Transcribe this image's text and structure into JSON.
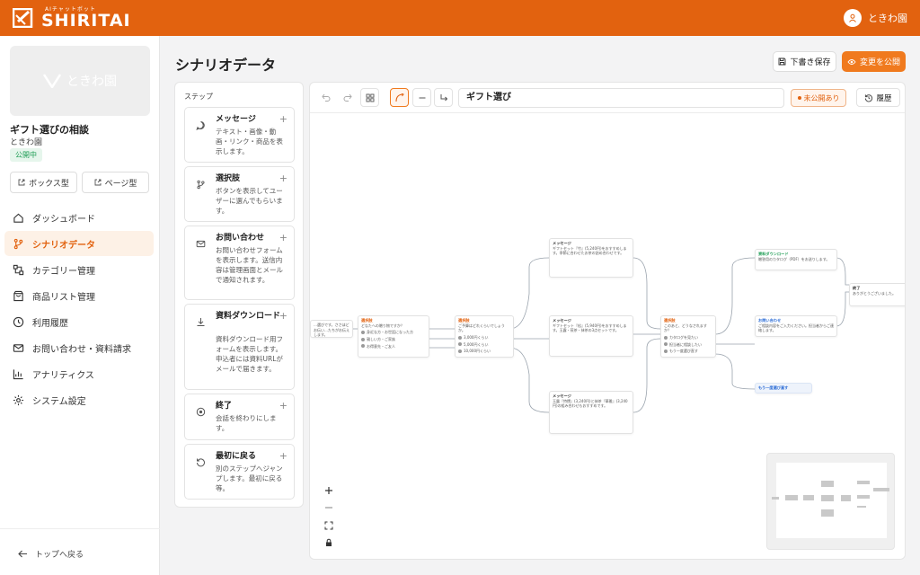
{
  "header": {
    "logo_sub": "AIチャットボット",
    "logo_main": "SHIRITAI",
    "user_name": "ときわ園"
  },
  "project": {
    "thumb_text": "ときわ園",
    "title": "ギフト選びの相談",
    "owner": "ときわ園",
    "status": "公開中",
    "box_type": "ボックス型",
    "page_type": "ページ型"
  },
  "nav": [
    {
      "label": "ダッシュボード",
      "icon": "home-icon"
    },
    {
      "label": "シナリオデータ",
      "icon": "branch-icon",
      "active": true
    },
    {
      "label": "カテゴリー管理",
      "icon": "category-icon"
    },
    {
      "label": "商品リスト管理",
      "icon": "bag-icon"
    },
    {
      "label": "利用履歴",
      "icon": "clock-icon"
    },
    {
      "label": "お問い合わせ・資料請求",
      "icon": "mail-icon"
    },
    {
      "label": "アナリティクス",
      "icon": "chart-icon"
    },
    {
      "label": "システム設定",
      "icon": "gear-icon"
    }
  ],
  "back_label": "トップへ戻る",
  "page_title": "シナリオデータ",
  "actions": {
    "draft": "下書き保存",
    "publish": "変更を公開"
  },
  "steps_label": "ステップ",
  "steps": [
    {
      "title": "メッセージ",
      "desc": "テキスト・画像・動画・リンク・商品を表示します。"
    },
    {
      "title": "選択肢",
      "desc": "ボタンを表示してユーザーに選んでもらいます。"
    },
    {
      "title": "お問い合わせ",
      "desc": "お問い合わせフォームを表示します。送信内容は管理画面とメールで通知されます。"
    },
    {
      "title": "資料ダウンロード",
      "desc": "資料ダウンロード用フォームを表示します。申込者には資料URLがメールで届きます。"
    },
    {
      "title": "終了",
      "desc": "会話を終わりにします。"
    },
    {
      "title": "最初に戻る",
      "desc": "別のステップへジャンプします。最初に戻る等。"
    }
  ],
  "editor": {
    "scenario_name": "ギフト選び",
    "unpublished": "未公開あり",
    "history": "履歴"
  },
  "flow": {
    "start_text": "…選びです。ささほどお伝い…たちがお伝えします。",
    "choice1": {
      "title": "選択肢",
      "q": "どなたへの贈り物ですか？",
      "options": [
        "身近な方・お世話になった方",
        "親しい方・ご家族",
        "お得意先・ご友人"
      ]
    },
    "choice2": {
      "title": "選択肢",
      "q": "ご予算はどれくらいでしょうか。",
      "options": [
        "3,000円くらい",
        "5,000円くらい",
        "10,000円くらい"
      ]
    },
    "msg1": {
      "title": "メッセージ",
      "text": "ギフトセット『竹』(5,240円)をおすすめします。季節に合わせたお茶の詰め合わせです。"
    },
    "msg2": {
      "title": "メッセージ",
      "text": "ギフトセット『松』(5,940円)をおすすめします。玉露・煎茶・抹茶の3点セットです。"
    },
    "msg3": {
      "title": "メッセージ",
      "text": "玉露『特撰』(3,240円)と抹茶『華雅』(3,240円)の組み合わせもおすすめです。"
    },
    "choice3": {
      "title": "選択肢",
      "q": "このあと、どうなされますか？",
      "options": [
        "カタログを見たい",
        "担当者に相談したい",
        "もう一度選び直す"
      ]
    },
    "download": {
      "title": "資料ダウンロード",
      "text": "贈答用のカタログ（PDF）をお送りします。"
    },
    "contact": {
      "title": "お問い合わせ",
      "text": "ご相談内容をご入力ください。担当者からご連絡します。"
    },
    "end": {
      "title": "終了",
      "text": "ありがとうございました。"
    },
    "restart": {
      "title": "もう一度選び直す"
    }
  }
}
